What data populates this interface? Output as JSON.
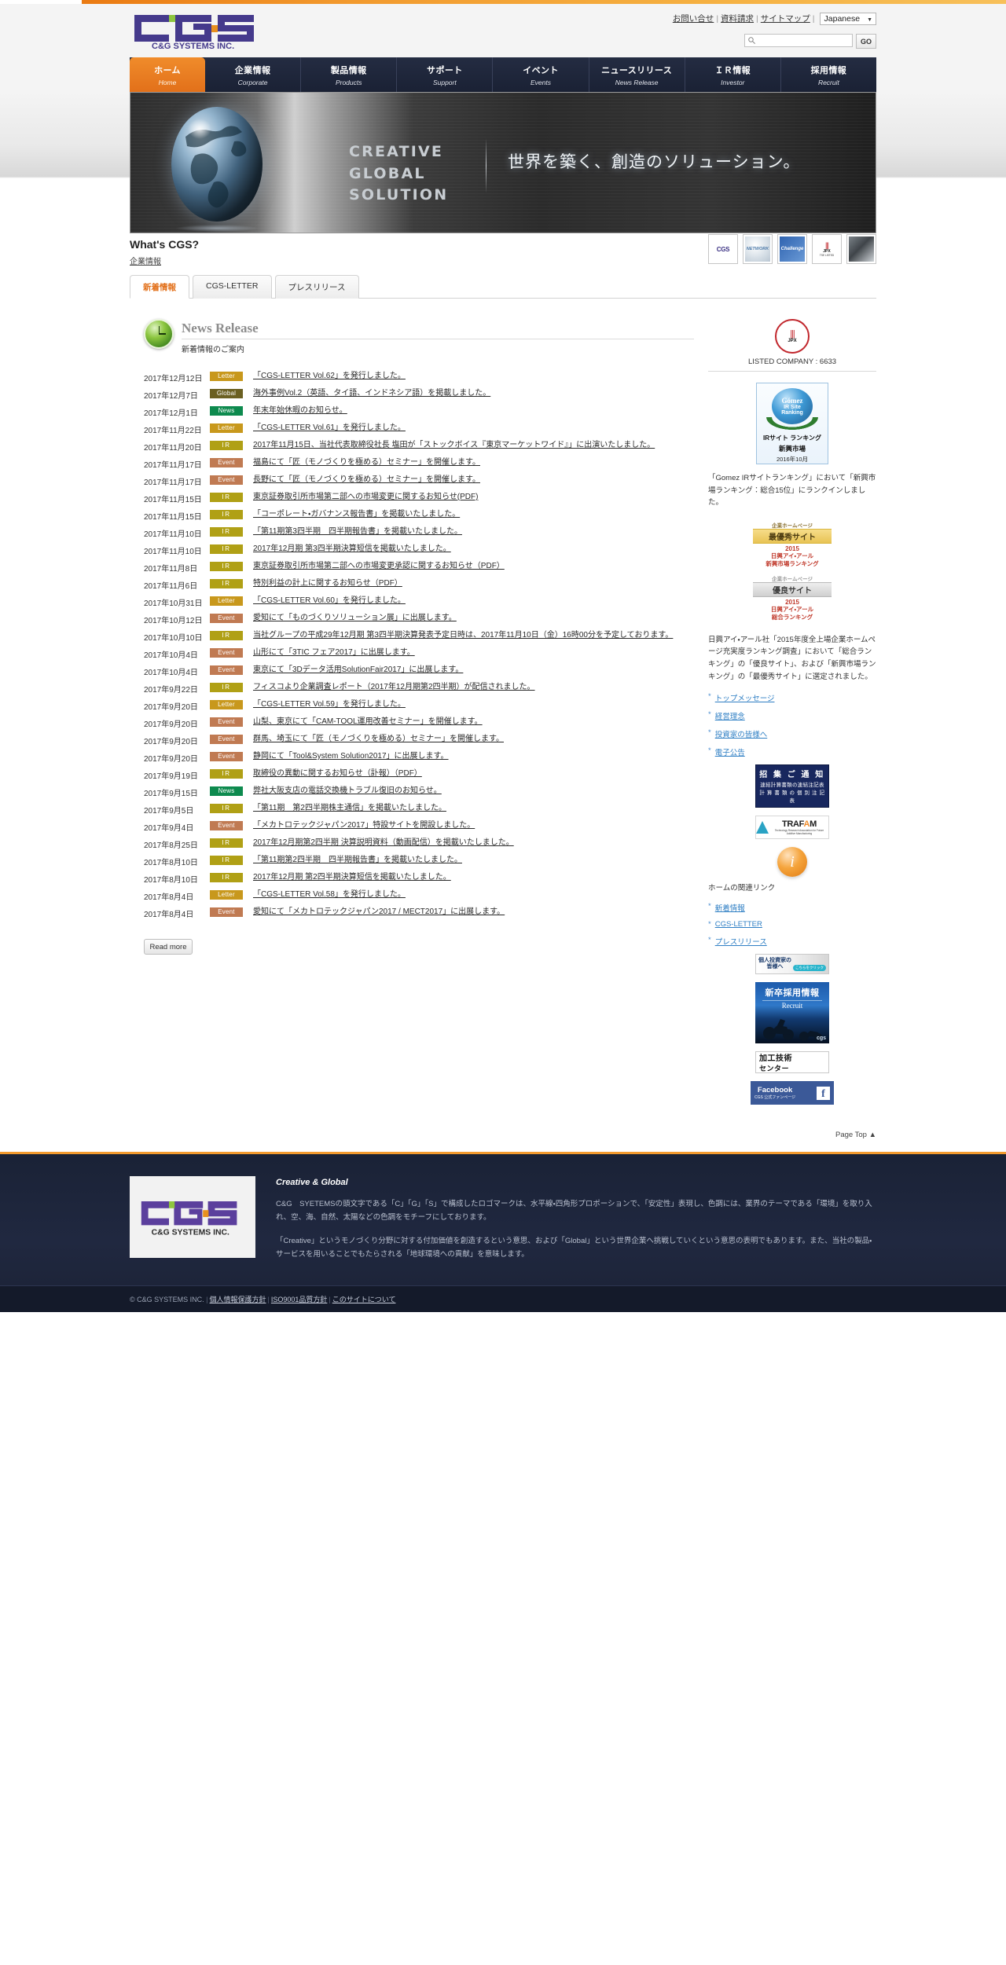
{
  "header": {
    "logo_main": "CGS",
    "logo_sub": "C&G SYSTEMS INC.",
    "util_links": [
      "お問い合せ",
      "資料請求",
      "サイトマップ"
    ],
    "language": "Japanese",
    "search_placeholder": "",
    "search_value": "",
    "go_label": "GO"
  },
  "nav": [
    {
      "ja": "ホーム",
      "en": "Home",
      "active": true
    },
    {
      "ja": "企業情報",
      "en": "Corporate",
      "active": false
    },
    {
      "ja": "製品情報",
      "en": "Products",
      "active": false
    },
    {
      "ja": "サポート",
      "en": "Support",
      "active": false
    },
    {
      "ja": "イベント",
      "en": "Events",
      "active": false
    },
    {
      "ja": "ニュースリリース",
      "en": "News Release",
      "active": false
    },
    {
      "ja": "ＩＲ情報",
      "en": "Investor",
      "active": false
    },
    {
      "ja": "採用情報",
      "en": "Recruit",
      "active": false
    }
  ],
  "hero": {
    "line1": "CREATIVE",
    "line2": "GLOBAL",
    "line3": "SOLUTION",
    "tagline_ja": "世界を築く、創造のソリューション。"
  },
  "whats": {
    "title": "What's CGS?",
    "link": "企業情報",
    "thumbs": [
      "cgs-logo-thumb",
      "network-thumb",
      "challenge-thumb",
      "jpx-thumb",
      "movie-thumb"
    ]
  },
  "tabs": [
    {
      "label": "新着情報",
      "active": true
    },
    {
      "label": "CGS-LETTER",
      "active": false
    },
    {
      "label": "プレスリリース",
      "active": false
    }
  ],
  "section": {
    "title_en": "News Release",
    "title_ja": "新着情報のご案内",
    "read_more": "Read more"
  },
  "news": [
    {
      "date": "2017年12月12日",
      "cat": "Letter",
      "text": "「CGS-LETTER Vol.62」を発行しました。"
    },
    {
      "date": "2017年12月7日",
      "cat": "Global",
      "text": "海外事例Vol.2（英語、タイ語、インドネシア語）を掲載しました。"
    },
    {
      "date": "2017年12月1日",
      "cat": "News",
      "text": "年末年始休暇のお知らせ。"
    },
    {
      "date": "2017年11月22日",
      "cat": "Letter",
      "text": "「CGS-LETTER Vol.61」を発行しました。"
    },
    {
      "date": "2017年11月20日",
      "cat": "IR",
      "text": "2017年11月15日、当社代表取締役社長 塩田が「ストックボイス『東京マーケットワイド』」に出演いたしました。"
    },
    {
      "date": "2017年11月17日",
      "cat": "Event",
      "text": "福島にて「匠（モノづくりを極める）セミナー」を開催します。"
    },
    {
      "date": "2017年11月17日",
      "cat": "Event",
      "text": "長野にて「匠（モノづくりを極める）セミナー」を開催します。"
    },
    {
      "date": "2017年11月15日",
      "cat": "IR",
      "text": "東京証券取引所市場第二部への市場変更に関するお知らせ(PDF)"
    },
    {
      "date": "2017年11月15日",
      "cat": "IR",
      "text": "「コーポレート・ガバナンス報告書」を掲載いたしました。"
    },
    {
      "date": "2017年11月10日",
      "cat": "IR",
      "text": "「第11期第3四半期　四半期報告書」を掲載いたしました。"
    },
    {
      "date": "2017年11月10日",
      "cat": "IR",
      "text": "2017年12月期 第3四半期決算短信を掲載いたしました。"
    },
    {
      "date": "2017年11月8日",
      "cat": "IR",
      "text": "東京証券取引所市場第二部への市場変更承認に関するお知らせ（PDF）"
    },
    {
      "date": "2017年11月6日",
      "cat": "IR",
      "text": "特別利益の計上に関するお知らせ（PDF）"
    },
    {
      "date": "2017年10月31日",
      "cat": "Letter",
      "text": "「CGS-LETTER Vol.60」を発行しました。"
    },
    {
      "date": "2017年10月12日",
      "cat": "Event",
      "text": "愛知にて「ものづくりソリューション展」に出展します。"
    },
    {
      "date": "2017年10月10日",
      "cat": "IR",
      "text": "当社グループの平成29年12月期 第3四半期決算発表予定日時は、2017年11月10日（金）16時00分を予定しております。"
    },
    {
      "date": "2017年10月4日",
      "cat": "Event",
      "text": "山形にて「3TIC フェア2017」に出展します。"
    },
    {
      "date": "2017年10月4日",
      "cat": "Event",
      "text": "東京にて「3Dデータ活用SolutionFair2017」に出展します。"
    },
    {
      "date": "2017年9月22日",
      "cat": "IR",
      "text": "フィスコより企業調査レポート（2017年12月期第2四半期）が配信されました。"
    },
    {
      "date": "2017年9月20日",
      "cat": "Letter",
      "text": "「CGS-LETTER Vol.59」を発行しました。"
    },
    {
      "date": "2017年9月20日",
      "cat": "Event",
      "text": "山梨、東京にて「CAM-TOOL運用改善セミナー」を開催します。"
    },
    {
      "date": "2017年9月20日",
      "cat": "Event",
      "text": "群馬、埼玉にて「匠（モノづくりを極める）セミナー」を開催します。"
    },
    {
      "date": "2017年9月20日",
      "cat": "Event",
      "text": "静岡にて「Tool&System Solution2017」に出展します。"
    },
    {
      "date": "2017年9月19日",
      "cat": "IR",
      "text": "取締役の異動に関するお知らせ（訃報）（PDF）"
    },
    {
      "date": "2017年9月15日",
      "cat": "News",
      "text": "弊社大阪支店の電話交換機トラブル復旧のお知らせ。"
    },
    {
      "date": "2017年9月5日",
      "cat": "IR",
      "text": "「第11期　第2四半期株主通信」を掲載いたしました。"
    },
    {
      "date": "2017年9月4日",
      "cat": "Event",
      "text": "「メカトロテックジャパン2017」特設サイトを開設しました。"
    },
    {
      "date": "2017年8月25日",
      "cat": "IR",
      "text": "2017年12月期第2四半期 決算説明資料（動画配信）を掲載いたしました。"
    },
    {
      "date": "2017年8月10日",
      "cat": "IR",
      "text": "「第11期第2四半期　四半期報告書」を掲載いたしました。"
    },
    {
      "date": "2017年8月10日",
      "cat": "IR",
      "text": "2017年12月期 第2四半期決算短信を掲載いたしました。"
    },
    {
      "date": "2017年8月4日",
      "cat": "Letter",
      "text": "「CGS-LETTER Vol.58」を発行しました。"
    },
    {
      "date": "2017年8月4日",
      "cat": "Event",
      "text": "愛知にて「メカトロテックジャパン2017 / MECT2017」に出展します。"
    }
  ],
  "sidebar": {
    "jpx_bars": "|||",
    "jpx_label": "JPX",
    "listed": "LISTED COMPANY : 6633",
    "gomez": {
      "name": "Gómez",
      "line1": "IR Site",
      "line2": "Ranking",
      "cap1": "IRサイト ランキング",
      "cap2": "新興市場",
      "cap3": "2016年10月"
    },
    "gomez_text": "「Gomez IRサイトランキング」において「新興市場ランキング：総合15位」にランクインしました。",
    "ribbon_gold": {
      "top": "企業ホームページ",
      "band": "最優秀サイト",
      "year": "2015",
      "line": "日興アイ・アール\n新興市場ランキング"
    },
    "ribbon_silver": {
      "top": "企業ホームページ",
      "band": "優良サイト",
      "year": "2015",
      "line": "日興アイ・アール\n総合ランキング"
    },
    "nikko_text": "日興アイ・アール社「2015年度全上場企業ホームページ充実度ランキング調査」において「総合ランキング」の「優良サイト」、および「新興市場ランキング」の「最優秀サイト」に選定されました。",
    "links_ir": [
      "トップメッセージ",
      "経営理念",
      "投資家の皆様へ",
      "電子公告"
    ],
    "shoshu": {
      "l1": "招 集 ご 通 知",
      "l2": "連結計算書類の連結注記表",
      "l3": "計 算 書 類 の 個 別 注 記 表"
    },
    "trafam": {
      "name": "TRAFAM",
      "sub": "Technology Research Association for Future Additive Manufacturing"
    },
    "info_caption": "ホームの関連リンク",
    "links_home": [
      "新着情報",
      "CGS-LETTER",
      "プレスリリース"
    ],
    "kojin": {
      "l1": "個人投資家の",
      "l2": "皆様へ",
      "pill": "こちらをクリック"
    },
    "recruit": {
      "l1": "新卒採用情報",
      "l2": "Recruit",
      "logo": "cgs"
    },
    "kakou": {
      "l1": "加工技術",
      "l2": "センター"
    },
    "facebook": {
      "l1": "Facebook",
      "l2": "CGS 公式ファンページ",
      "icon": "f"
    }
  },
  "pagetop": "Page Top ▲",
  "footer": {
    "logo_main": "CGS",
    "logo_sub": "C&G SYSTEMS INC.",
    "title": "Creative & Global",
    "para1": "C&G　SYETEMSの頭文字である「C」「G」「S」で構成したロゴマークは、水平線・四角形プロポーションで、「安定性」表現し、色調には、業界のテーマである「環境」を取り入れ、空、海、自然、太陽などの色調をモチーフにしております。",
    "para2": "「Creative」というモノづくり分野に対する付加価値を創造するという意思、および「Global」という世界企業へ挑戦していくという意思の表明でもあります。また、当社の製品・サービスを用いることでもたらされる「地球環境への貢献」を意味します。",
    "copyright": "© C&G SYSTEMS INC.",
    "links": [
      "個人情報保護方針",
      "ISO9001品質方針",
      "このサイトについて"
    ]
  }
}
